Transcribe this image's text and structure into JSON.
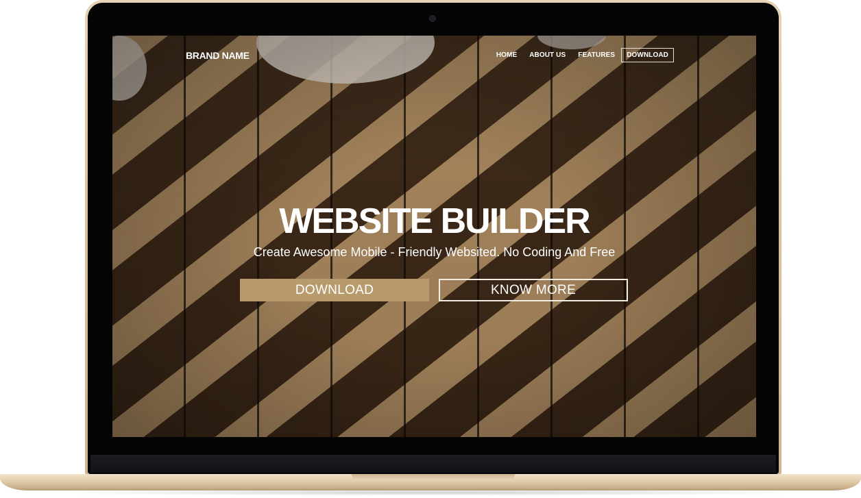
{
  "nav": {
    "brand": "BRAND NAME",
    "items": [
      {
        "label": "HOME"
      },
      {
        "label": "ABOUT US"
      },
      {
        "label": "FEATURES"
      },
      {
        "label": "DOWNLOAD",
        "outlined": true
      }
    ]
  },
  "hero": {
    "title": "WEBSITE BUILDER",
    "subtitle": "Create Awesome Mobile - Friendly Websited. No Coding And Free",
    "primary_button": "DOWNLOAD",
    "secondary_button": "KNOW MORE"
  },
  "colors": {
    "accent": "#b79b6c",
    "laptop_gold": "#dcc7a5",
    "bezel": "#050505"
  }
}
